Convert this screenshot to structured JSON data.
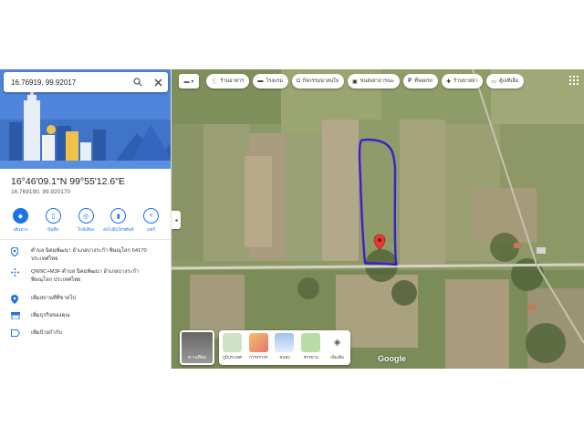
{
  "search": {
    "query": "16.76919, 99.92017"
  },
  "place": {
    "title": "16°46'09.1\"N 99°55'12.6\"E",
    "decimal": "16.769190, 99.920170"
  },
  "actions": [
    {
      "label": "เส้นทาง",
      "icon": "directions-icon"
    },
    {
      "label": "บันทึก",
      "icon": "bookmark-icon"
    },
    {
      "label": "ใกล้เคียง",
      "icon": "nearby-icon"
    },
    {
      "label": "ส่งไปยังโทรศัพท์",
      "icon": "phone-icon"
    },
    {
      "label": "แชร์",
      "icon": "share-icon"
    }
  ],
  "info": {
    "address": "ตำบล นิคมพัฒนา อำเภอบางระกำ พิษณุโลก 64170 ประเทศไทย",
    "plus_code": "QW9C+M3F ตำบล นิคมพัฒนา อำเภอบางระกำ พิษณุโลก ประเทศไทย",
    "add_place": "เพิ่มสถานที่ที่ขาดไป",
    "add_business": "เพิ่มธุรกิจของคุณ",
    "add_label": "เพิ่มป้ายกำกับ"
  },
  "chips": [
    {
      "label": "ร้านอาหาร",
      "icon": "restaurant-icon"
    },
    {
      "label": "โรงแรม",
      "icon": "hotel-icon"
    },
    {
      "label": "กิจกรรมน่าสนใจ",
      "icon": "camera-icon"
    },
    {
      "label": "ขนส่งสาธารณะ",
      "icon": "transit-icon"
    },
    {
      "label": "ที่จอดรถ",
      "icon": "parking-icon"
    },
    {
      "label": "ร้านขายยา",
      "icon": "pharmacy-icon"
    },
    {
      "label": "ตู้เอทีเอ็ม",
      "icon": "atm-icon"
    }
  ],
  "map": {
    "satellite_label": "ดาวเทียม",
    "layers": [
      {
        "label": "ภูมิประเทศ",
        "color": "#cfe3c4"
      },
      {
        "label": "การจราจร",
        "color": "#f5c26b"
      },
      {
        "label": "ขนส่ง",
        "color": "#9ec3f0"
      },
      {
        "label": "จักรยาน",
        "color": "#b9dca8"
      },
      {
        "label": "เพิ่มเติม",
        "color": "#ffffff"
      }
    ],
    "brand": "Google",
    "outline_color": "#3a1fd1",
    "pin_color": "#e53935"
  }
}
